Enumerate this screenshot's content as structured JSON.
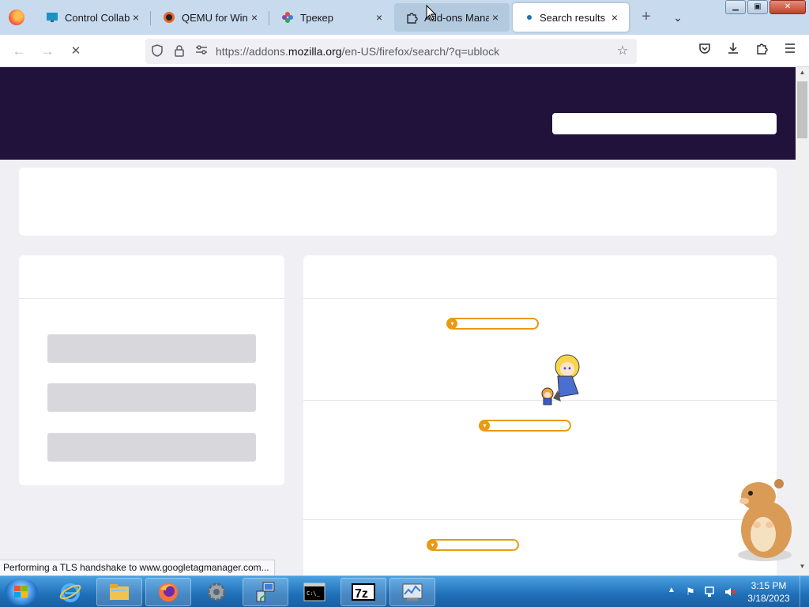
{
  "browser": {
    "tabs": [
      {
        "title": "Control Collabora",
        "close": "×",
        "icon": "monitor-icon"
      },
      {
        "title": "QEMU for Windows",
        "close": "×",
        "icon": "qemu-icon"
      },
      {
        "title": "Трекер",
        "close": "×",
        "icon": "pinwheel-icon"
      },
      {
        "title": "Add-ons Manager",
        "close": "×",
        "icon": "puzzle-icon"
      },
      {
        "title": "Search results for",
        "close": "×",
        "icon": "loading-dot"
      }
    ],
    "new_tab": "+",
    "tab_list": "⌄",
    "window_controls": {
      "minimize": "▁",
      "maximize": "▣",
      "close": "✕"
    },
    "nav": {
      "back": "←",
      "forward": "→",
      "stop": "✕"
    },
    "url": {
      "prefix": "https://addons.",
      "host": "mozilla.org",
      "path": "/en-US/firefox/search/?q=ublock"
    },
    "toolbar_icons": [
      "pocket-icon",
      "download-icon",
      "extensions-icon",
      "menu-icon"
    ]
  },
  "page": {
    "header_color": "#20123a",
    "search_placeholder": "",
    "status_toast": "Performing a TLS handshake to www.googletagmanager.com...",
    "accent": "#e89a14"
  },
  "taskbar": {
    "apps": [
      "internet-explorer-icon",
      "file-explorer-icon",
      "firefox-icon",
      "settings-gear-icon",
      "network-computer-icon",
      "command-prompt-icon",
      "7zip-icon",
      "performance-monitor-icon"
    ],
    "apps_labels": {
      "cmd": "C:\\_",
      "sevenzip": "7z"
    },
    "clock": {
      "time": "3:15 PM",
      "date": "3/18/2023"
    }
  }
}
